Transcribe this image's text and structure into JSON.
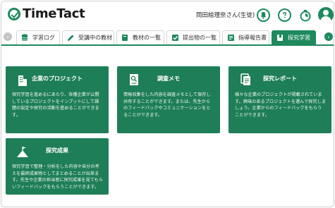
{
  "app": {
    "logo_text": "TimeTact",
    "user_name": "岡田絵理奈さん(生徒)"
  },
  "header_icons": [
    "bell-icon",
    "help-icon",
    "timer-icon",
    "avatar"
  ],
  "tabs": [
    {
      "label": "学習ログ",
      "icon": "database-icon"
    },
    {
      "label": "受講中の教材",
      "icon": "pencil-icon"
    },
    {
      "label": "教材の一覧",
      "icon": "book-icon"
    },
    {
      "label": "提出物の一覧",
      "icon": "check-icon"
    },
    {
      "label": "指導報告書",
      "icon": "report-icon"
    },
    {
      "label": "探究学習",
      "icon": "bookmark-icon",
      "active": true
    }
  ],
  "cards": [
    {
      "title": "企業のプロジェクト",
      "icon": "building-icon",
      "description": "探究学習を進めるにあたり、各種企業が公開しているプロジェクトをインプットにして課題の設定や探究の活動を進めることができます。"
    },
    {
      "title": "調査メモ",
      "icon": "memo-search-icon",
      "description": "情報収集をした内容を調査メモとして保存し共有することができます。または、先生からのフィードバックやコミュニケーションをとることができます。"
    },
    {
      "title": "探究レポート",
      "icon": "document-icon",
      "description": "様々な企業のプロジェクトが掲載されています。興味のあるプロジェクトを選んで探究しましょう。企業からのフィードバックをもらうことができます。"
    },
    {
      "title": "探究成果",
      "icon": "flag-mountain-icon",
      "description": "探究学習で整理・分析をした内容や自分の考えを最終成果物としてまとめることが出来ます。先生や企業の担当者に探究成果を見てもらいフィードバックをもらうことができます。"
    }
  ],
  "colors": {
    "brand": "#1e8a5e",
    "card": "#1e7e57"
  }
}
